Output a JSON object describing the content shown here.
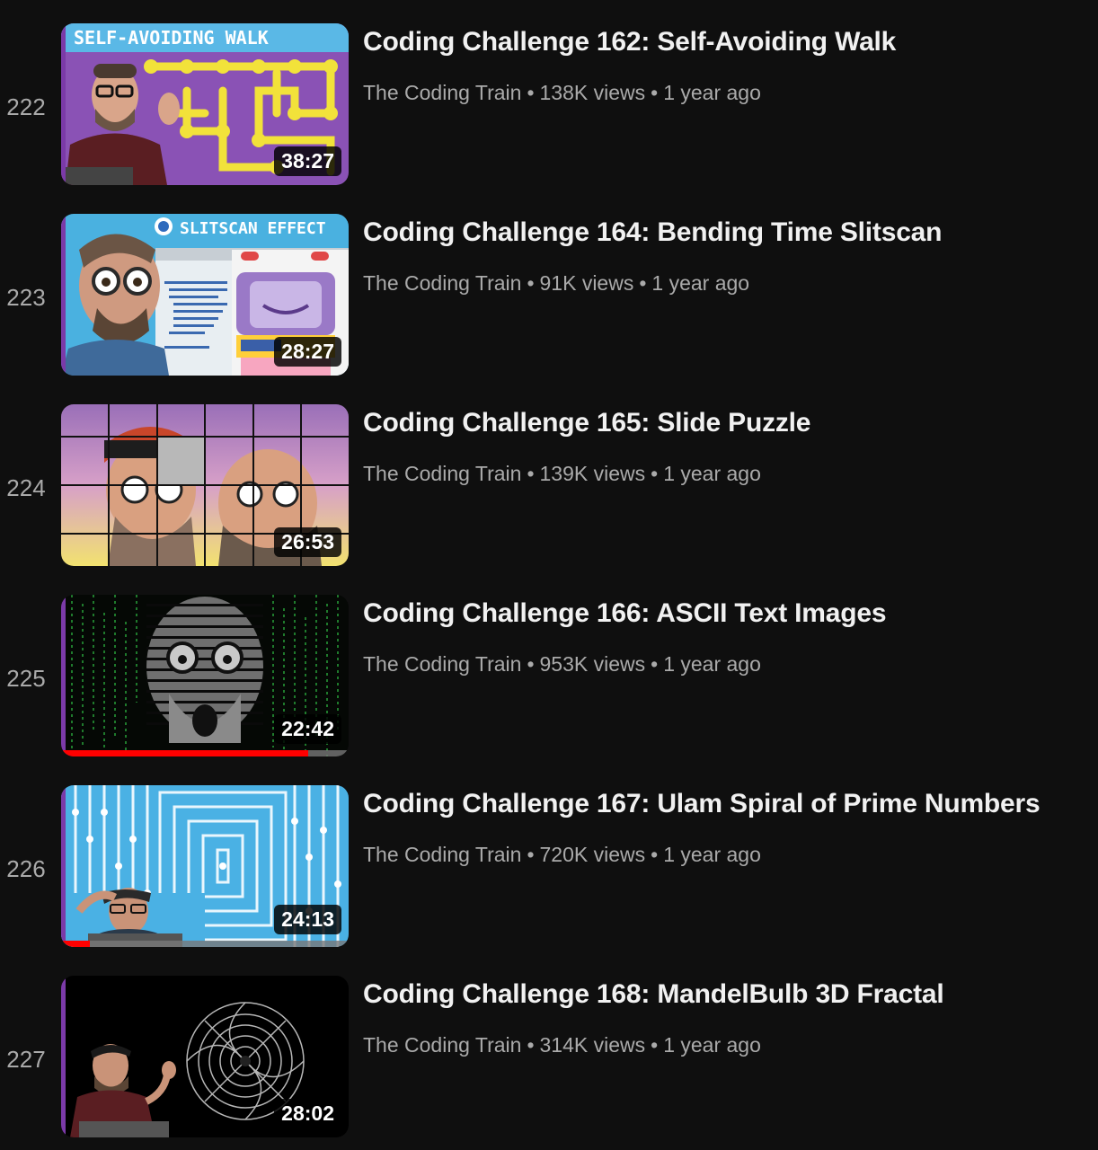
{
  "playlist": {
    "items": [
      {
        "index": "222",
        "title": "Coding Challenge 162: Self-Avoiding Walk",
        "channel": "The Coding Train",
        "views": "138K views",
        "age": "1 year ago",
        "duration": "38:27",
        "thumb_caption": "SELF-AVOIDING WALK",
        "watch_progress": null
      },
      {
        "index": "223",
        "title": "Coding Challenge 164: Bending Time Slitscan",
        "channel": "The Coding Train",
        "views": "91K views",
        "age": "1 year ago",
        "duration": "28:27",
        "thumb_caption": "SLITSCAN EFFECT",
        "watch_progress": null
      },
      {
        "index": "224",
        "title": "Coding Challenge 165: Slide Puzzle",
        "channel": "The Coding Train",
        "views": "139K views",
        "age": "1 year ago",
        "duration": "26:53",
        "thumb_caption": "",
        "watch_progress": null
      },
      {
        "index": "225",
        "title": "Coding Challenge 166: ASCII Text Images",
        "channel": "The Coding Train",
        "views": "953K views",
        "age": "1 year ago",
        "duration": "22:42",
        "thumb_caption": "",
        "watch_progress": 0.86
      },
      {
        "index": "226",
        "title": "Coding Challenge 167: Ulam Spiral of Prime Numbers",
        "channel": "The Coding Train",
        "views": "720K views",
        "age": "1 year ago",
        "duration": "24:13",
        "thumb_caption": "",
        "watch_progress": 0.1
      },
      {
        "index": "227",
        "title": "Coding Challenge 168: MandelBulb 3D Fractal",
        "channel": "The Coding Train",
        "views": "314K views",
        "age": "1 year ago",
        "duration": "28:02",
        "thumb_caption": "",
        "watch_progress": null
      }
    ]
  },
  "colors": {
    "background": "#0f0f0f",
    "title_text": "#f1f1f1",
    "meta_text": "#aaaaaa",
    "progress_red": "#ff0000",
    "playlist_edge": "#7b3aa8"
  }
}
